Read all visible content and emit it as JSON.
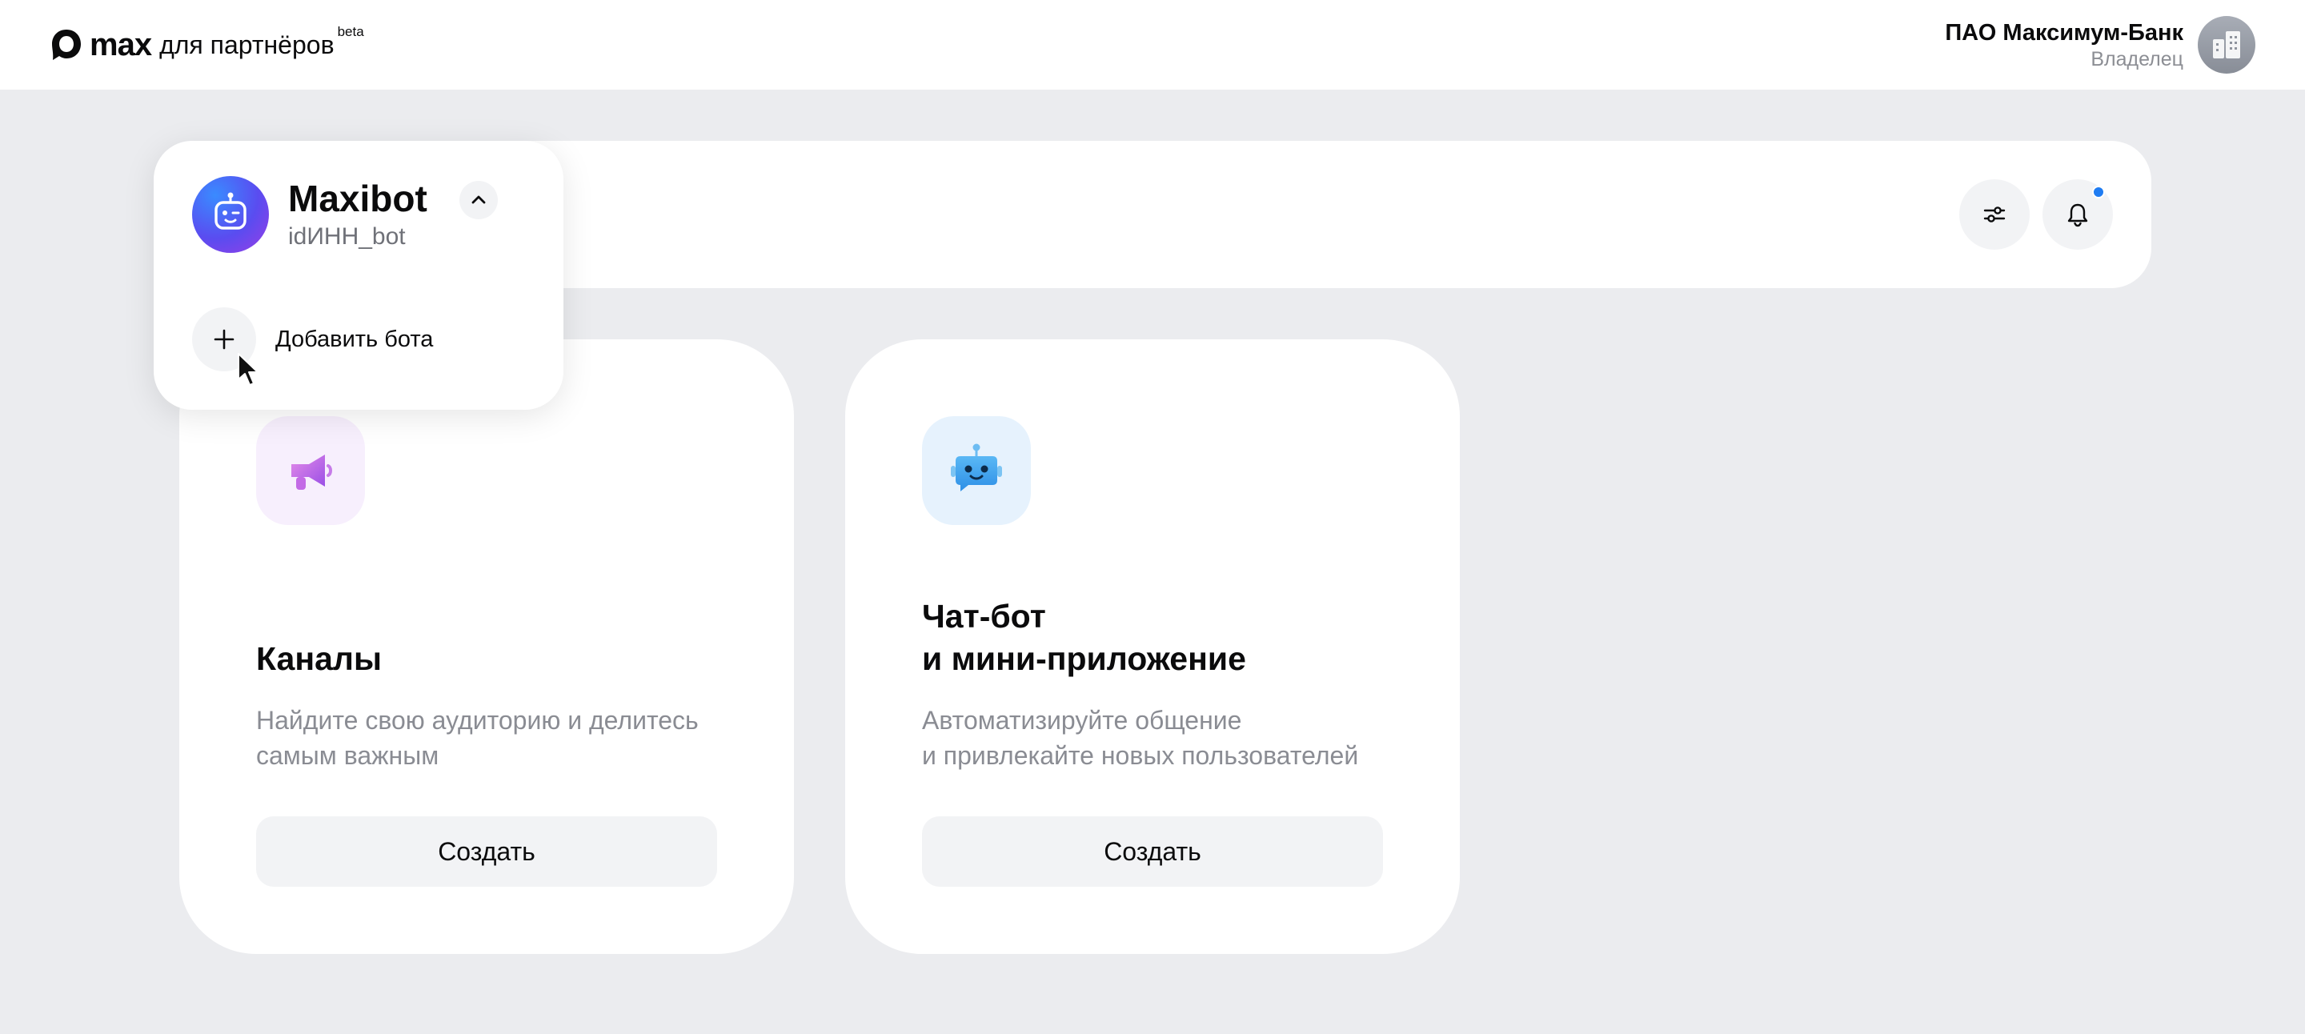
{
  "app": {
    "logo_word": "max",
    "logo_sub": "для партнёров",
    "logo_badge": "beta"
  },
  "account": {
    "name": "ПАО Максимум-Банк",
    "role": "Владелец",
    "avatar_icon": "buildings-icon"
  },
  "header": {
    "filters_icon": "sliders-icon",
    "notifications_icon": "bell-icon",
    "has_unread_notifications": true
  },
  "bot_switcher": {
    "expanded": true,
    "current_bot": {
      "name": "Maxibot",
      "handle": "idИНН_bot",
      "avatar_icon": "robot-face-icon"
    },
    "add_bot_label": "Добавить бота"
  },
  "cards": [
    {
      "icon": "megaphone-icon",
      "title": "Каналы",
      "description": "Найдите свою аудиторию и делитесь самым важным",
      "button": "Создать"
    },
    {
      "icon": "chat-bot-icon",
      "title": "Чат-бот\nи мини-приложение",
      "description": "Автоматизируйте общение\nи привлекайте новых пользователей",
      "button": "Создать"
    }
  ],
  "colors": {
    "accent_blue": "#1f7cf2",
    "page_background": "#ebecef",
    "card_background": "#ffffff",
    "button_background": "#f2f3f5",
    "muted_text": "#8a8c93"
  }
}
